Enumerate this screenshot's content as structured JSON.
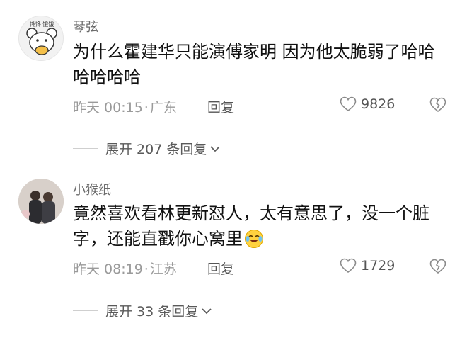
{
  "comments": [
    {
      "username": "琴弦",
      "avatar_label": "馋馋 饿饿",
      "text": "为什么霍建华只能演傅家明 因为他太脆弱了哈哈哈哈哈哈",
      "meta": {
        "time": "昨天 00:15",
        "location": "广东"
      },
      "reply_label": "回复",
      "likes": "9826",
      "expand_label": "展开 207 条回复"
    },
    {
      "username": "小猴纸",
      "text": "竟然喜欢看林更新怼人，太有意思了，没一个脏字，还能直戳你心窝里",
      "meta": {
        "time": "昨天 08:19",
        "location": "江苏"
      },
      "reply_label": "回复",
      "likes": "1729",
      "expand_label": "展开 33 条回复"
    }
  ],
  "icons": {
    "like": "heart-outline-icon",
    "dislike": "broken-heart-icon",
    "expand": "chevron-down-icon",
    "emoji": "laugh-cry-emoji-icon"
  },
  "colors": {
    "username": "#6b6b6b",
    "meta": "#9a9a9a",
    "text": "#111111"
  }
}
